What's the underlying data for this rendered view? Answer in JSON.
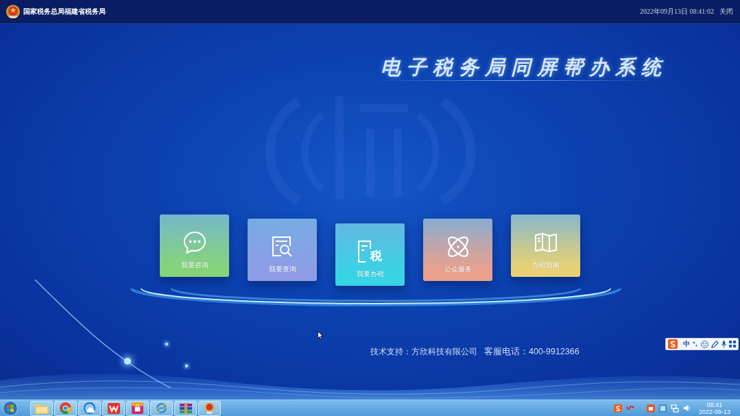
{
  "header": {
    "agency_name": "国家税务总局福建省税务局",
    "datetime": "2022年09月13日 08:41:02",
    "close": "关闭"
  },
  "title": "电子税务局同屏帮办系统",
  "tiles": [
    {
      "label": "我要咨询",
      "color": "#86d47a"
    },
    {
      "label": "我要查询",
      "color": "#8e9de6"
    },
    {
      "label": "我要办税",
      "color": "#36d4e4",
      "icon_text": "税"
    },
    {
      "label": "公众服务",
      "color": "#eba08c"
    },
    {
      "label": "办税指南",
      "color": "#e6d274"
    }
  ],
  "footer": {
    "support": "技术支持：方欣科技有限公司",
    "hotline": "客服电话：400-9912366"
  },
  "ime_bar": {
    "mode": "中"
  },
  "taskbar": {
    "clock": {
      "time": "08:41",
      "date": "2022-09-13"
    }
  }
}
